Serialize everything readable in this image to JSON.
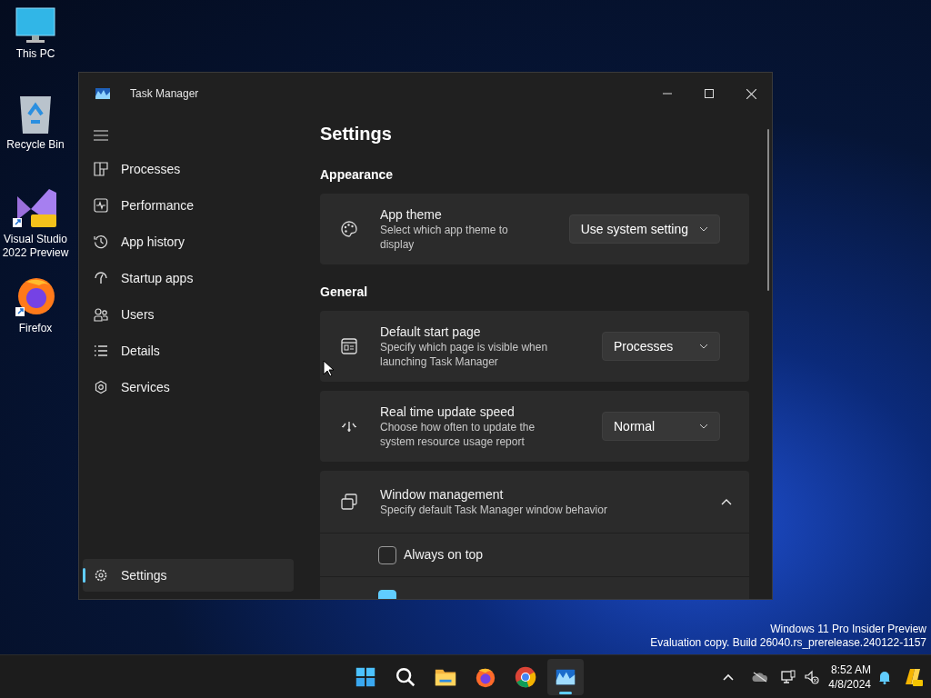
{
  "desktop_icons": [
    {
      "label": "This PC",
      "kind": "pc"
    },
    {
      "label": "Recycle Bin",
      "kind": "bin"
    },
    {
      "label": "Visual Studio 2022 Preview",
      "kind": "vs"
    },
    {
      "label": "Firefox",
      "kind": "firefox"
    }
  ],
  "window": {
    "title": "Task Manager"
  },
  "sidebar": {
    "items": [
      {
        "label": "Processes",
        "kind": "processes",
        "selected": false
      },
      {
        "label": "Performance",
        "kind": "performance",
        "selected": false
      },
      {
        "label": "App history",
        "kind": "history",
        "selected": false
      },
      {
        "label": "Startup apps",
        "kind": "startup",
        "selected": false
      },
      {
        "label": "Users",
        "kind": "users",
        "selected": false
      },
      {
        "label": "Details",
        "kind": "details",
        "selected": false
      },
      {
        "label": "Services",
        "kind": "services",
        "selected": false
      }
    ],
    "footer": {
      "label": "Settings",
      "kind": "settings",
      "selected": true
    }
  },
  "page_title": "Settings",
  "sections": [
    {
      "heading": "Appearance",
      "cards": [
        {
          "kind": "dropdown",
          "title": "App theme",
          "description": "Select which app theme to display",
          "value": "Use system setting"
        }
      ]
    },
    {
      "heading": "General",
      "cards": [
        {
          "kind": "dropdown",
          "title": "Default start page",
          "description": "Specify which page is visible when launching Task Manager",
          "value": "Processes"
        },
        {
          "kind": "dropdown",
          "title": "Real time update speed",
          "description": "Choose how often to update the system resource usage report",
          "value": "Normal"
        },
        {
          "kind": "expander",
          "title": "Window management",
          "description": "Specify default Task Manager window behavior",
          "expanded": true,
          "options": [
            {
              "label": "Always on top",
              "checked": false
            },
            {
              "checked": true
            }
          ]
        }
      ]
    }
  ],
  "watermark_text": [
    "Windows 11 Pro Insider Preview",
    "Evaluation copy. Build 26040.rs_prerelease.240122-1157"
  ],
  "taskbar": {
    "apps": [
      {
        "kind": "start",
        "active": false
      },
      {
        "kind": "search",
        "active": false
      },
      {
        "kind": "explorer",
        "active": false
      },
      {
        "kind": "firefox",
        "active": false
      },
      {
        "kind": "chrome",
        "active": false
      },
      {
        "kind": "taskmgr",
        "active": true
      }
    ],
    "time": "8:52 AM",
    "date": "4/8/2024"
  }
}
